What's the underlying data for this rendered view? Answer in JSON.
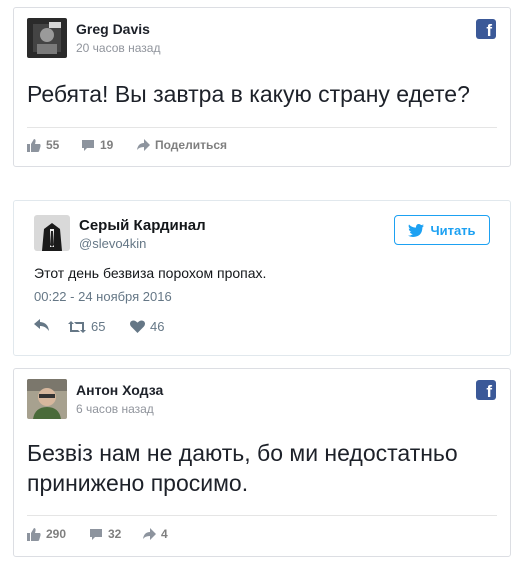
{
  "post1": {
    "author": "Greg Davis",
    "time": "20 часов назад",
    "text": "Ребята! Вы завтра в какую страну едете?",
    "likes": "55",
    "comments": "19",
    "share_label": "Поделиться",
    "logo_icon": "facebook-icon"
  },
  "tweet": {
    "name": "Серый Кардинал",
    "handle": "@slevo4kin",
    "follow_label": "Читать",
    "text": "Этот день безвиза порохом пропах.",
    "date": "00:22 - 24 ноября 2016",
    "retweets": "65",
    "likes": "46"
  },
  "post2": {
    "author": "Антон Ходза",
    "time": "6 часов назад",
    "text_line1": "Безвіз нам не дають, бо ми недостатньо",
    "text_line2": "принижено просимо.",
    "likes": "290",
    "comments": "32",
    "shares": "4",
    "logo_icon": "facebook-icon"
  },
  "colors": {
    "facebook": "#3b5998",
    "twitter": "#1da1f2",
    "muted": "#90949c"
  }
}
